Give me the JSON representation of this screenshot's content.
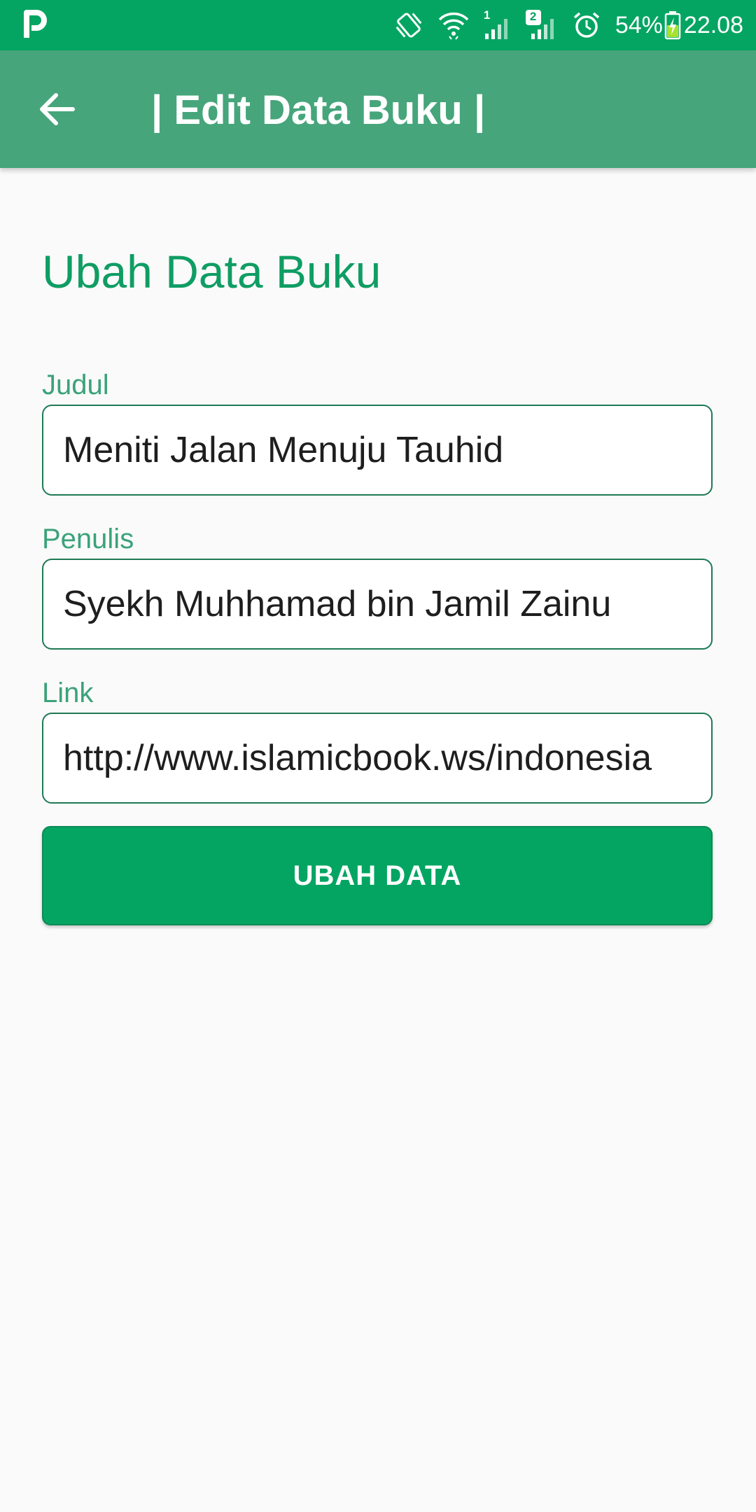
{
  "status_bar": {
    "battery_percent": "54%",
    "time": "22.08",
    "sim1_label": "1",
    "sim2_label": "2",
    "icons": [
      "p-logo-icon",
      "vibrate-icon",
      "wifi-icon",
      "signal-sim1-icon",
      "signal-sim2-icon",
      "alarm-icon",
      "battery-charging-icon"
    ]
  },
  "app_bar": {
    "title": "| Edit Data Buku |",
    "back_icon": "arrow-left-icon"
  },
  "form": {
    "heading": "Ubah Data Buku",
    "fields": [
      {
        "label": "Judul",
        "value": "Meniti Jalan Menuju Tauhid"
      },
      {
        "label": "Penulis",
        "value": "Syekh Muhhamad bin Jamil Zainu"
      },
      {
        "label": "Link",
        "value": "http://www.islamicbook.ws/indonesia"
      }
    ],
    "submit_label": "UBAH DATA"
  },
  "colors": {
    "status_bar": "#04a562",
    "app_bar": "#46a57b",
    "accent": "#0f9d63",
    "label": "#3ba27a",
    "field_border": "#1f7a55",
    "button": "#04a562",
    "background": "#fafafa"
  }
}
